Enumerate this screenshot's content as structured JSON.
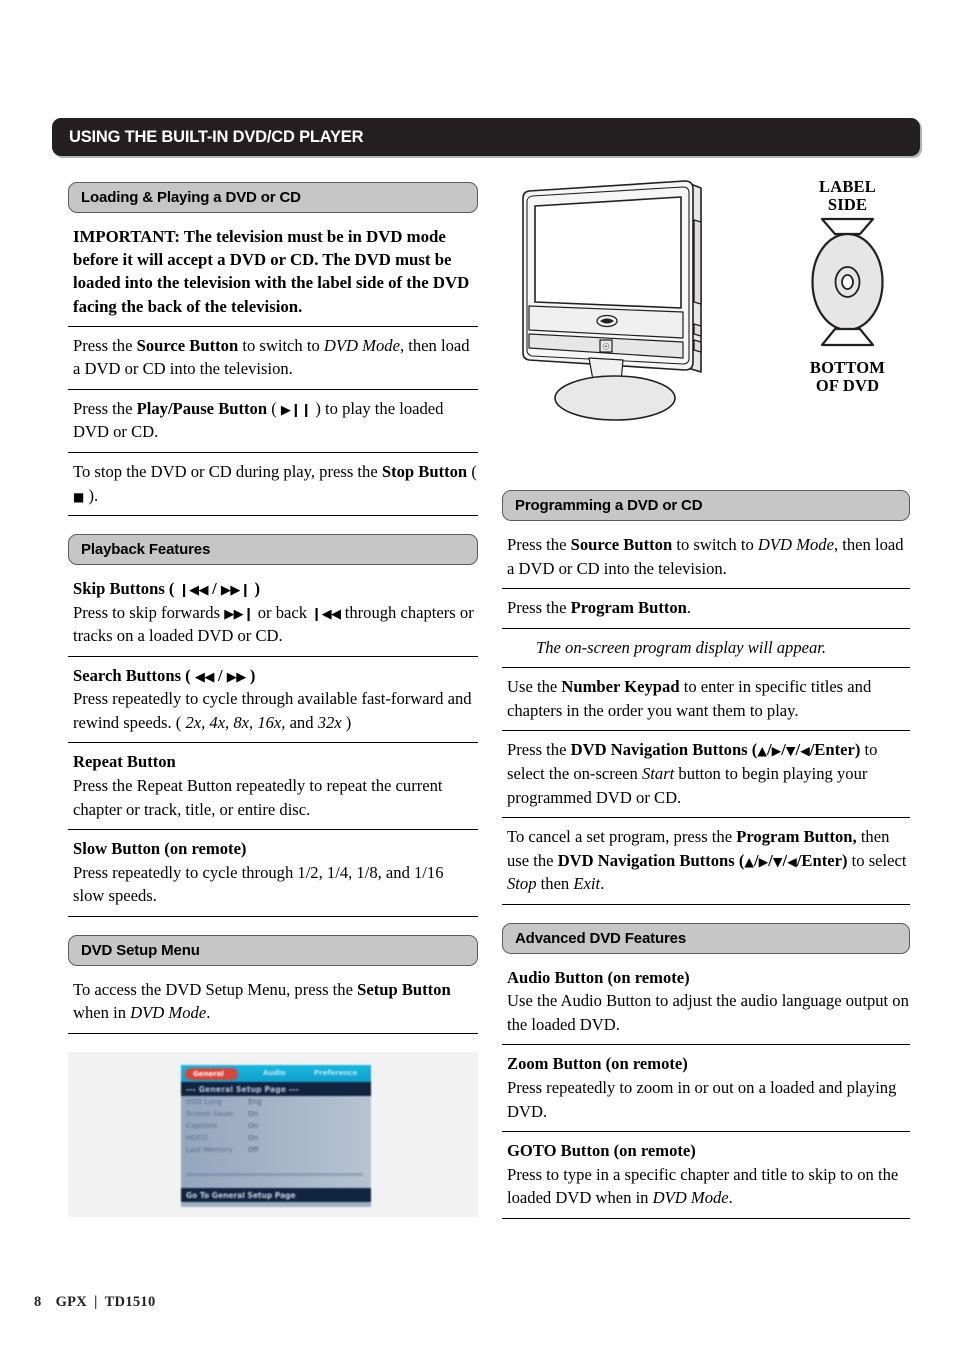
{
  "page": {
    "banner_title": "USING THE BUILT-IN DVD/CD PLAYER",
    "footer_page_number": "8",
    "footer_brand": "GPX",
    "footer_separator": "|",
    "footer_model": "TD1510"
  },
  "colors": {
    "banner_bg": "#231f20",
    "subbanner_bg": "#c6c6c6",
    "subbanner_border": "#5b5b5b",
    "osd_panel_bg": "#f2f2f2",
    "osd_tabbar": "#17b7e0",
    "osd_active_tab": "#d8453a",
    "osd_titlebar": "#11243f"
  },
  "illustration": {
    "tv_alt": "line drawing of flat-panel television with built-in DVD slot",
    "dvd_label_top_line1": "LABEL",
    "dvd_label_top_line2": "SIDE",
    "dvd_label_bottom_line1": "BOTTOM",
    "dvd_label_bottom_line2": "OF DVD"
  },
  "sections": {
    "loading": {
      "heading": "Loading & Playing a DVD or CD",
      "blocks": [
        {
          "id": "important",
          "runs": [
            {
              "t": "IMPORTANT: The television must be in DVD mode before it will accept a DVD or CD. The DVD must be loaded into the television with the label side of the DVD facing the back of the television.",
              "s": "b"
            }
          ]
        },
        {
          "id": "source",
          "runs": [
            {
              "t": "Press the ",
              "s": "n"
            },
            {
              "t": "Source Button",
              "s": "b"
            },
            {
              "t": " to switch to ",
              "s": "n"
            },
            {
              "t": "DVD Mode",
              "s": "i"
            },
            {
              "t": ", then load a DVD or CD into the television.",
              "s": "n"
            }
          ]
        },
        {
          "id": "playpause",
          "runs": [
            {
              "t": "Press the ",
              "s": "n"
            },
            {
              "t": "Play/Pause Button",
              "s": "b"
            },
            {
              "t": " ( ",
              "s": "n"
            },
            {
              "t": "▶❙❙",
              "s": "g"
            },
            {
              "t": " ) to play the loaded DVD or CD.",
              "s": "n"
            }
          ]
        },
        {
          "id": "stop",
          "runs": [
            {
              "t": "To stop the DVD or CD during play, press the ",
              "s": "n"
            },
            {
              "t": "Stop Button",
              "s": "b"
            },
            {
              "t": " ( ",
              "s": "n"
            },
            {
              "t": "■",
              "s": "gs"
            },
            {
              "t": " ).",
              "s": "n"
            }
          ]
        }
      ]
    },
    "playback": {
      "heading": "Playback Features",
      "blocks": [
        {
          "id": "skip",
          "title_runs": [
            {
              "t": "Skip Buttons ( ",
              "s": "b"
            },
            {
              "t": "❙◀◀",
              "s": "gb"
            },
            {
              "t": " / ",
              "s": "b"
            },
            {
              "t": "▶▶❙",
              "s": "gb"
            },
            {
              "t": " )",
              "s": "b"
            }
          ],
          "runs": [
            {
              "t": "Press to skip forwards ",
              "s": "n"
            },
            {
              "t": "▶▶❙",
              "s": "g"
            },
            {
              "t": " or back ",
              "s": "n"
            },
            {
              "t": "❙◀◀",
              "s": "g"
            },
            {
              "t": " through chapters or tracks on a loaded DVD or CD.",
              "s": "n"
            }
          ]
        },
        {
          "id": "search",
          "title_runs": [
            {
              "t": "Search Buttons ( ",
              "s": "b"
            },
            {
              "t": "◀◀",
              "s": "gb"
            },
            {
              "t": " / ",
              "s": "b"
            },
            {
              "t": "▶▶",
              "s": "gb"
            },
            {
              "t": " )",
              "s": "b"
            }
          ],
          "runs": [
            {
              "t": "Press repeatedly to cycle through available fast-forward and rewind speeds. ( ",
              "s": "n"
            },
            {
              "t": "2x, 4x, 8x, 16x,",
              "s": "i"
            },
            {
              "t": " and ",
              "s": "n"
            },
            {
              "t": "32x",
              "s": "i"
            },
            {
              "t": " )",
              "s": "n"
            }
          ]
        },
        {
          "id": "repeat",
          "title_runs": [
            {
              "t": "Repeat Button",
              "s": "b"
            }
          ],
          "runs": [
            {
              "t": "Press the Repeat Button repeatedly to repeat the current chapter or track, title, or entire disc.",
              "s": "n"
            }
          ]
        },
        {
          "id": "slow",
          "title_runs": [
            {
              "t": "Slow Button (on remote)",
              "s": "b"
            }
          ],
          "runs": [
            {
              "t": "Press repeatedly to cycle through 1/2, 1/4, 1/8, and 1/16 slow speeds.",
              "s": "n"
            }
          ]
        }
      ]
    },
    "setup": {
      "heading": "DVD Setup Menu",
      "blocks": [
        {
          "id": "setup-access",
          "runs": [
            {
              "t": "To access the DVD Setup Menu, press the ",
              "s": "n"
            },
            {
              "t": "Setup Button",
              "s": "b"
            },
            {
              "t": " when in ",
              "s": "n"
            },
            {
              "t": "DVD Mode",
              "s": "i"
            },
            {
              "t": ".",
              "s": "n"
            }
          ]
        }
      ],
      "osd": {
        "tabs": [
          "General",
          "Audio",
          "Preference"
        ],
        "title": "--- General Setup Page ---",
        "rows": [
          {
            "key": "OSD Lang",
            "value": "Eng"
          },
          {
            "key": "Screen Saver",
            "value": "On"
          },
          {
            "key": "Captions",
            "value": "On"
          },
          {
            "key": "HDCD",
            "value": "On"
          },
          {
            "key": "Last Memory",
            "value": "Off"
          }
        ],
        "footer": "Go To General Setup Page"
      }
    },
    "programming": {
      "heading": "Programming a DVD or CD",
      "blocks": [
        {
          "id": "prog-source",
          "runs": [
            {
              "t": "Press the ",
              "s": "n"
            },
            {
              "t": "Source Button",
              "s": "b"
            },
            {
              "t": " to switch to ",
              "s": "n"
            },
            {
              "t": "DVD Mode",
              "s": "i"
            },
            {
              "t": ", then load a DVD or CD into the television.",
              "s": "n"
            }
          ]
        },
        {
          "id": "prog-button",
          "runs": [
            {
              "t": "Press the ",
              "s": "n"
            },
            {
              "t": "Program Button",
              "s": "b"
            },
            {
              "t": ".",
              "s": "n"
            }
          ]
        },
        {
          "id": "prog-display",
          "indent": true,
          "runs": [
            {
              "t": "The on-screen program display will appear.",
              "s": "i"
            }
          ]
        },
        {
          "id": "prog-keypad",
          "runs": [
            {
              "t": "Use the ",
              "s": "n"
            },
            {
              "t": "Number Keypad",
              "s": "b"
            },
            {
              "t": " to enter in specific titles and chapters in the order you want them to play.",
              "s": "n"
            }
          ]
        },
        {
          "id": "prog-nav",
          "runs": [
            {
              "t": "Press the ",
              "s": "n"
            },
            {
              "t": "DVD Navigation Buttons (",
              "s": "b"
            },
            {
              "t": "▲",
              "s": "nb"
            },
            {
              "t": "/",
              "s": "b"
            },
            {
              "t": "▶",
              "s": "nb"
            },
            {
              "t": "/",
              "s": "b"
            },
            {
              "t": "▼",
              "s": "nb"
            },
            {
              "t": "/",
              "s": "b"
            },
            {
              "t": "◀",
              "s": "nb"
            },
            {
              "t": "/Enter)",
              "s": "b"
            },
            {
              "t": " to select the on-screen ",
              "s": "n"
            },
            {
              "t": "Start",
              "s": "i"
            },
            {
              "t": " button to begin playing your programmed DVD or CD.",
              "s": "n"
            }
          ]
        },
        {
          "id": "prog-cancel",
          "runs": [
            {
              "t": "To cancel a set program, press the ",
              "s": "n"
            },
            {
              "t": "Program Button,",
              "s": "b"
            },
            {
              "t": " then use the ",
              "s": "n"
            },
            {
              "t": "DVD Navigation Buttons (",
              "s": "b"
            },
            {
              "t": "▲",
              "s": "nb"
            },
            {
              "t": "/",
              "s": "b"
            },
            {
              "t": "▶",
              "s": "nb"
            },
            {
              "t": "/",
              "s": "b"
            },
            {
              "t": "▼",
              "s": "nb"
            },
            {
              "t": "/",
              "s": "b"
            },
            {
              "t": "◀",
              "s": "nb"
            },
            {
              "t": "/Enter)",
              "s": "b"
            },
            {
              "t": " to select ",
              "s": "n"
            },
            {
              "t": "Stop",
              "s": "i"
            },
            {
              "t": " then ",
              "s": "n"
            },
            {
              "t": "Exit",
              "s": "i"
            },
            {
              "t": ".",
              "s": "n"
            }
          ]
        }
      ]
    },
    "advanced": {
      "heading": "Advanced DVD Features",
      "blocks": [
        {
          "id": "audio-btn",
          "title_runs": [
            {
              "t": "Audio Button (on remote)",
              "s": "b"
            }
          ],
          "runs": [
            {
              "t": "Use the Audio Button to adjust the audio language output on the loaded DVD.",
              "s": "n"
            }
          ]
        },
        {
          "id": "zoom-btn",
          "title_runs": [
            {
              "t": "Zoom Button (on remote)",
              "s": "b"
            }
          ],
          "runs": [
            {
              "t": "Press repeatedly to zoom in or out on a loaded and playing DVD.",
              "s": "n"
            }
          ]
        },
        {
          "id": "goto-btn",
          "title_runs": [
            {
              "t": "GOTO Button (on remote)",
              "s": "b"
            }
          ],
          "runs": [
            {
              "t": "Press to type in a specific chapter and title to skip to on the loaded DVD when in ",
              "s": "n"
            },
            {
              "t": "DVD Mode",
              "s": "i"
            },
            {
              "t": ".",
              "s": "n"
            }
          ]
        }
      ]
    }
  }
}
